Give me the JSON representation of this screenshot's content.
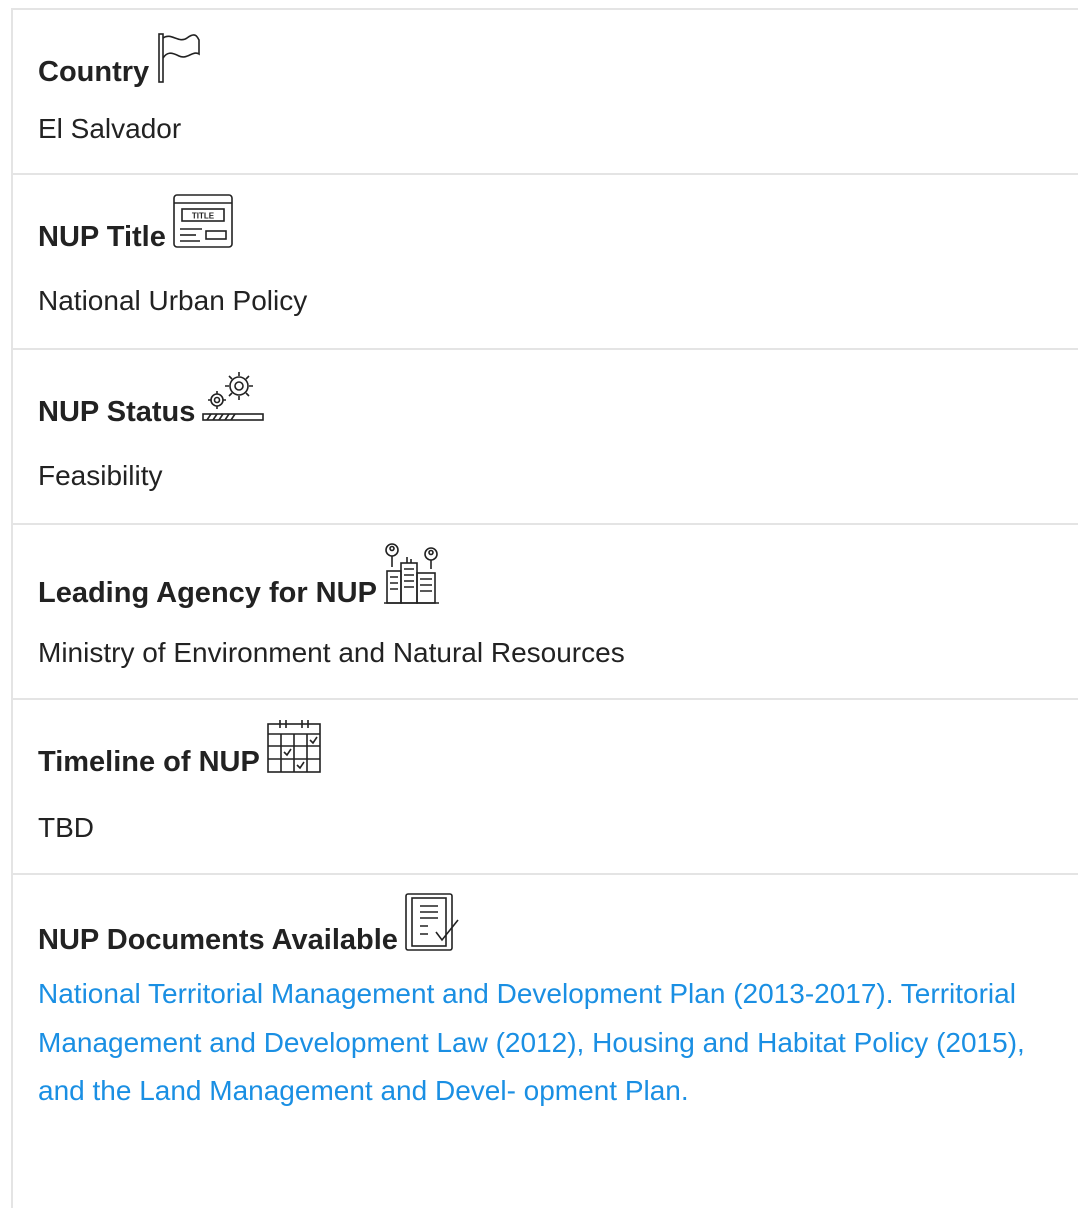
{
  "fields": {
    "country": {
      "label": "Country",
      "icon": "flag-icon",
      "value": "El Salvador"
    },
    "nup_title": {
      "label": "NUP Title",
      "icon": "title-icon",
      "value": "National Urban Policy"
    },
    "nup_status": {
      "label": "NUP Status",
      "icon": "gears-progress-icon",
      "value": "Feasibility"
    },
    "leading_agency": {
      "label": "Leading Agency for NUP",
      "icon": "city-agency-icon",
      "value": "Ministry of Environment and Natural Resources"
    },
    "timeline": {
      "label": "Timeline of NUP",
      "icon": "calendar-icon",
      "value": "TBD"
    },
    "documents": {
      "label": "NUP Documents Available",
      "icon": "document-check-icon",
      "link_text": "National Territorial Management and Development Plan (2013-2017). Territorial Management and Development Law (2012), Housing and Habitat Policy (2015), and the Land Management and Devel- opment Plan."
    }
  },
  "colors": {
    "link": "#1a8fe3",
    "text": "#222222",
    "divider": "#e4e4e4"
  }
}
